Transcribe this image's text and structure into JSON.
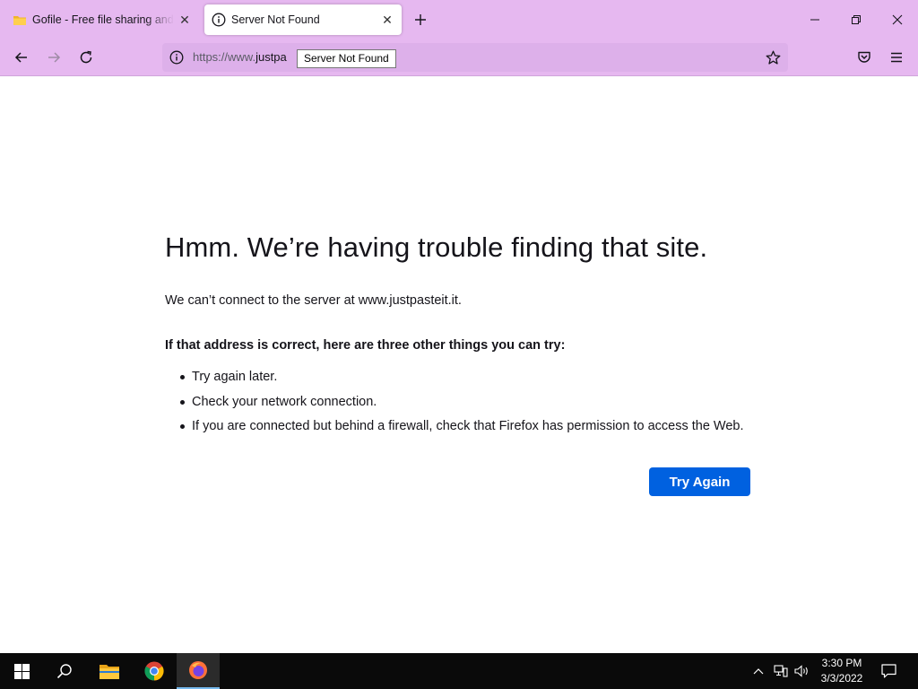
{
  "tabs": [
    {
      "title": "Gofile - Free file sharing and storage",
      "close": "✕",
      "favicon": "folder-favicon-icon"
    },
    {
      "title": "Server Not Found",
      "close": "✕",
      "favicon": "info-circle-icon"
    }
  ],
  "toolbar": {
    "new_tab": "+",
    "url_prefix": "https://www.",
    "url_host": "justpa",
    "tooltip": "Server Not Found"
  },
  "error": {
    "title": "Hmm. We’re having trouble finding that site.",
    "description": "We can’t connect to the server at www.justpasteit.it.",
    "subtitle": "If that address is correct, here are three other things you can try:",
    "items": [
      "Try again later.",
      "Check your network connection.",
      "If you are connected but behind a firewall, check that Firefox has permission to access the Web."
    ],
    "button": "Try Again"
  },
  "taskbar": {
    "time": "3:30 PM",
    "date": "3/3/2022"
  },
  "colors": {
    "chrome": "#e6b8f0",
    "primary_button": "#0061e0",
    "taskbar": "#0a0a0a"
  }
}
